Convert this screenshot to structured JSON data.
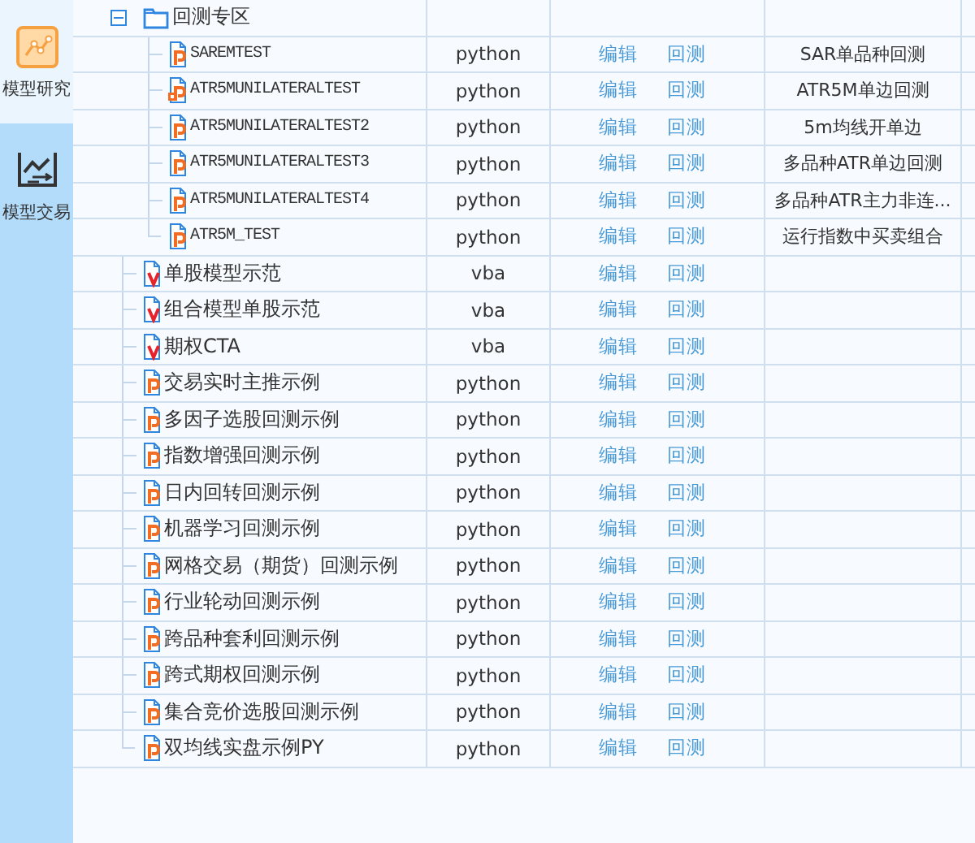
{
  "sidebar": {
    "items": [
      {
        "label": "模型研究",
        "selected": true
      },
      {
        "label": "模型交易",
        "selected": false
      }
    ]
  },
  "table": {
    "rows": [
      {
        "kind": "folder",
        "name": "回测专区",
        "expanded": true,
        "children": [
          {
            "kind": "python",
            "name": "SAREMTEST",
            "locked": false,
            "language": "python",
            "actions": [
              "编辑",
              "回测"
            ],
            "description": "SAR单品种回测"
          },
          {
            "kind": "python",
            "name": "ATR5MUNILATERALTEST",
            "locked": true,
            "language": "python",
            "actions": [
              "编辑",
              "回测"
            ],
            "description": "ATR5M单边回测"
          },
          {
            "kind": "python",
            "name": "ATR5MUNILATERALTEST2",
            "locked": false,
            "language": "python",
            "actions": [
              "编辑",
              "回测"
            ],
            "description": "5m均线开单边"
          },
          {
            "kind": "python",
            "name": "ATR5MUNILATERALTEST3",
            "locked": false,
            "language": "python",
            "actions": [
              "编辑",
              "回测"
            ],
            "description": "多品种ATR单边回测"
          },
          {
            "kind": "python",
            "name": "ATR5MUNILATERALTEST4",
            "locked": false,
            "language": "python",
            "actions": [
              "编辑",
              "回测"
            ],
            "description": "多品种ATR主力非连..."
          },
          {
            "kind": "python",
            "name": "ATR5M_TEST",
            "locked": false,
            "language": "python",
            "actions": [
              "编辑",
              "回测"
            ],
            "description": "运行指数中买卖组合"
          }
        ]
      },
      {
        "kind": "vba",
        "name": "单股模型示范",
        "locked": false,
        "language": "vba",
        "actions": [
          "编辑",
          "回测"
        ]
      },
      {
        "kind": "vba",
        "name": "组合模型单股示范",
        "locked": false,
        "language": "vba",
        "actions": [
          "编辑",
          "回测"
        ]
      },
      {
        "kind": "vba",
        "name": "期权CTA",
        "locked": false,
        "language": "vba",
        "actions": [
          "编辑",
          "回测"
        ]
      },
      {
        "kind": "python",
        "name": "交易实时主推示例",
        "locked": false,
        "language": "python",
        "actions": [
          "编辑",
          "回测"
        ]
      },
      {
        "kind": "python",
        "name": "多因子选股回测示例",
        "locked": false,
        "language": "python",
        "actions": [
          "编辑",
          "回测"
        ]
      },
      {
        "kind": "python",
        "name": "指数增强回测示例",
        "locked": false,
        "language": "python",
        "actions": [
          "编辑",
          "回测"
        ]
      },
      {
        "kind": "python",
        "name": "日内回转回测示例",
        "locked": false,
        "language": "python",
        "actions": [
          "编辑",
          "回测"
        ]
      },
      {
        "kind": "python",
        "name": "机器学习回测示例",
        "locked": false,
        "language": "python",
        "actions": [
          "编辑",
          "回测"
        ]
      },
      {
        "kind": "python",
        "name": "网格交易（期货）回测示例",
        "locked": false,
        "language": "python",
        "actions": [
          "编辑",
          "回测"
        ]
      },
      {
        "kind": "python",
        "name": "行业轮动回测示例",
        "locked": false,
        "language": "python",
        "actions": [
          "编辑",
          "回测"
        ]
      },
      {
        "kind": "python",
        "name": "跨品种套利回测示例",
        "locked": false,
        "language": "python",
        "actions": [
          "编辑",
          "回测"
        ]
      },
      {
        "kind": "python",
        "name": "跨式期权回测示例",
        "locked": false,
        "language": "python",
        "actions": [
          "编辑",
          "回测"
        ]
      },
      {
        "kind": "python",
        "name": "集合竞价选股回测示例",
        "locked": false,
        "language": "python",
        "actions": [
          "编辑",
          "回测"
        ]
      },
      {
        "kind": "python",
        "name": "双均线实盘示例PY",
        "locked": false,
        "language": "python",
        "actions": [
          "编辑",
          "回测"
        ]
      }
    ]
  }
}
